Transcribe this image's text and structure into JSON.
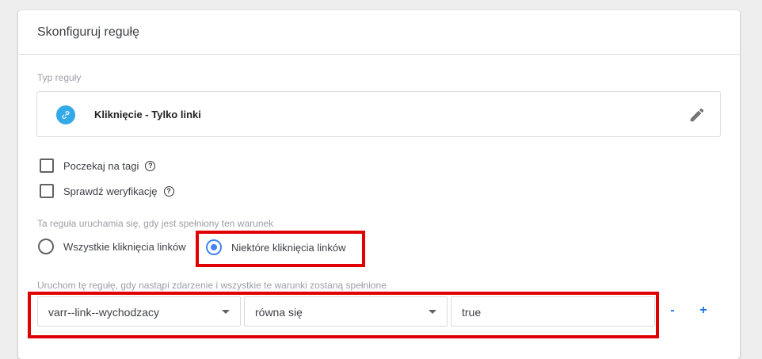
{
  "header": {
    "title": "Skonfiguruj regułę"
  },
  "rule_type": {
    "section_label": "Typ reguły",
    "name": "Kliknięcie - Tylko linki",
    "icon": "link-icon",
    "edit_icon": "pencil-icon",
    "accent_color": "#33a9e8"
  },
  "options": [
    {
      "label": "Poczekaj na tagi",
      "checked": false,
      "help_icon": "help-icon"
    },
    {
      "label": "Sprawdź weryfikację",
      "checked": false,
      "help_icon": "help-icon"
    }
  ],
  "fire_condition": {
    "section_label": "Ta reguła uruchamia się, gdy jest spełniony ten warunek",
    "choices": [
      {
        "label": "Wszystkie kliknięcia linków",
        "selected": false
      },
      {
        "label": "Niektóre kliknięcia linków",
        "selected": true
      }
    ]
  },
  "conditions": {
    "section_label": "Uruchom tę regułę, gdy nastąpi zdarzenie i wszystkie te warunki zostaną spełnione",
    "row": {
      "variable": "varr--link--wychodzacy",
      "operator": "równa się",
      "value": "true"
    },
    "remove_label": "-",
    "add_label": "+"
  },
  "highlight_color": "#e00000"
}
